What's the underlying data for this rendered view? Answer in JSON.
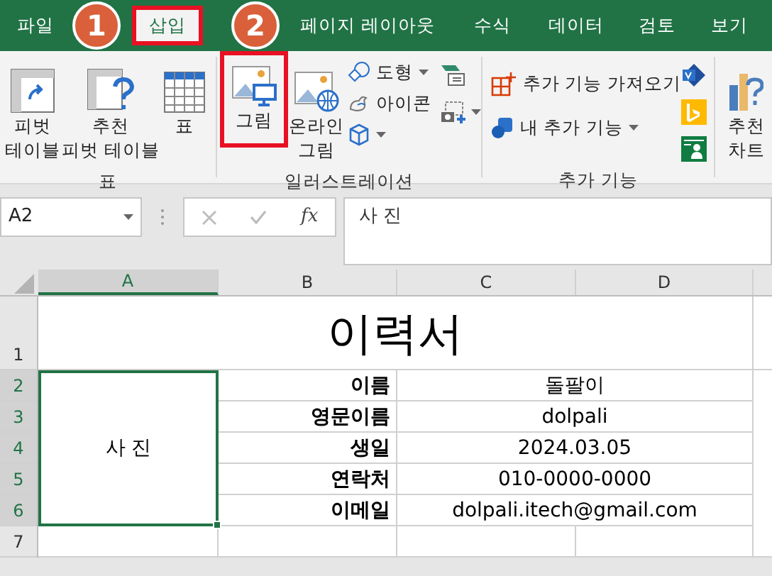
{
  "ribbon_tabs": [
    {
      "label": "파일",
      "selected": false,
      "highlighted": false
    },
    {
      "label": "삽입",
      "selected": true,
      "highlighted": true
    },
    {
      "label": "페이지 레이아웃",
      "selected": false,
      "highlighted": false
    },
    {
      "label": "수식",
      "selected": false,
      "highlighted": false
    },
    {
      "label": "데이터",
      "selected": false,
      "highlighted": false
    },
    {
      "label": "검토",
      "selected": false,
      "highlighted": false
    },
    {
      "label": "보기",
      "selected": false,
      "highlighted": false
    }
  ],
  "annotations": [
    {
      "number": "1"
    },
    {
      "number": "2"
    }
  ],
  "ribbon_groups": [
    {
      "title": "표",
      "items": [
        {
          "lines": [
            "피벗",
            "테이블"
          ]
        },
        {
          "lines": [
            "추천",
            "피벗 테이블"
          ]
        },
        {
          "lines": [
            "표"
          ]
        }
      ]
    },
    {
      "title": "일러스트레이션",
      "items": [
        {
          "kind": "large",
          "lines": [
            "그림"
          ],
          "highlighted": true
        },
        {
          "kind": "large",
          "lines": [
            "온라인",
            "그림"
          ],
          "highlighted": false
        },
        {
          "kind": "small",
          "label": "도형",
          "dropdown": true
        },
        {
          "kind": "small",
          "label": "아이콘",
          "dropdown": false
        },
        {
          "kind": "small",
          "dropdown": true
        },
        {
          "kind": "icon",
          "dropdown": false
        },
        {
          "kind": "icon",
          "dropdown": true
        }
      ]
    },
    {
      "title": "추가 기능",
      "items": [
        {
          "kind": "small",
          "label": "추가 기능 가져오기",
          "dropdown": false
        },
        {
          "kind": "small",
          "label": "내 추가 기능",
          "dropdown": true
        },
        {
          "kind": "icon"
        },
        {
          "kind": "icon"
        },
        {
          "kind": "icon"
        }
      ]
    },
    {
      "items": [
        {
          "lines": [
            "추천",
            "차트"
          ]
        }
      ]
    }
  ],
  "name_box": {
    "value": "A2"
  },
  "formula_buttons": {
    "function": "fx"
  },
  "formula_bar": {
    "value": "사 진"
  },
  "columns": [
    {
      "label": "A",
      "selected": true
    },
    {
      "label": "B",
      "selected": false
    },
    {
      "label": "C",
      "selected": false
    },
    {
      "label": "D",
      "selected": false
    }
  ],
  "rows": [
    {
      "label": "1",
      "selected": false
    },
    {
      "label": "2",
      "selected": true
    },
    {
      "label": "3",
      "selected": true
    },
    {
      "label": "4",
      "selected": true
    },
    {
      "label": "5",
      "selected": true
    },
    {
      "label": "6",
      "selected": true
    },
    {
      "label": "7",
      "selected": false
    }
  ],
  "sheet": {
    "title": "이력서",
    "photo_cell": "사 진",
    "fields": [
      {
        "label": "이름",
        "value": "돌팔이"
      },
      {
        "label": "영문이름",
        "value": "dolpali"
      },
      {
        "label": "생일",
        "value": "2024.03.05"
      },
      {
        "label": "연락처",
        "value": "010-0000-0000"
      },
      {
        "label": "이메일",
        "value": "dolpali.itech@gmail.com"
      }
    ]
  }
}
